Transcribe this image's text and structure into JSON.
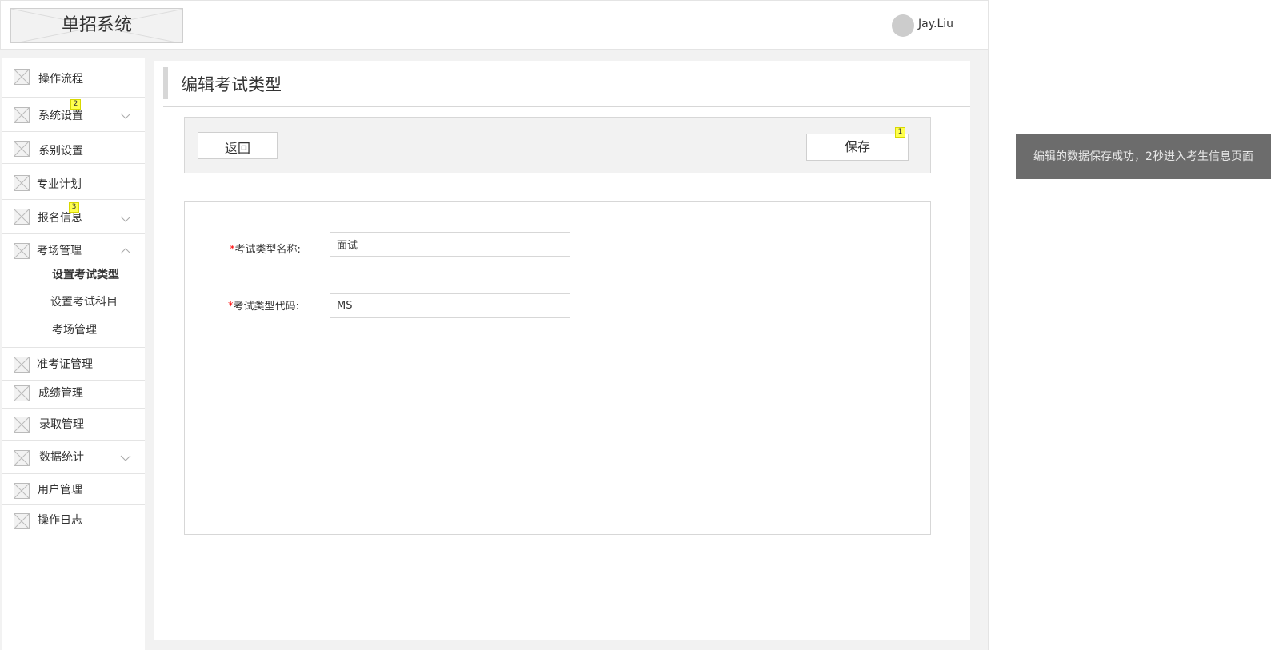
{
  "header": {
    "logo_text": "单招系统",
    "username": "Jay.Liu"
  },
  "sidebar": {
    "items": [
      {
        "label": "操作流程"
      },
      {
        "label": "系统设置",
        "badge": "2"
      },
      {
        "label": "系别设置"
      },
      {
        "label": "专业计划"
      },
      {
        "label": "报名信息",
        "badge": "3"
      },
      {
        "label": "考场管理",
        "children": [
          "设置考试类型",
          "设置考试科目",
          "考场管理"
        ]
      },
      {
        "label": "准考证管理"
      },
      {
        "label": "成绩管理"
      },
      {
        "label": "录取管理"
      },
      {
        "label": "数据统计"
      },
      {
        "label": "用户管理"
      },
      {
        "label": "操作日志"
      }
    ]
  },
  "main": {
    "title": "编辑考试类型",
    "back_label": "返回",
    "save_label": "保存",
    "save_badge": "1",
    "form": {
      "required_mark": "*",
      "name_label": "考试类型名称:",
      "name_value": "面试",
      "code_label": "考试类型代码:",
      "code_value": "MS"
    }
  },
  "toast": {
    "message": "编辑的数据保存成功，2秒进入考生信息页面"
  },
  "colors": {
    "required": "#ff0000",
    "badge": "#ffff4d",
    "toast_bg": "#6c6c6c",
    "panel_bg": "#f2f2f2"
  }
}
